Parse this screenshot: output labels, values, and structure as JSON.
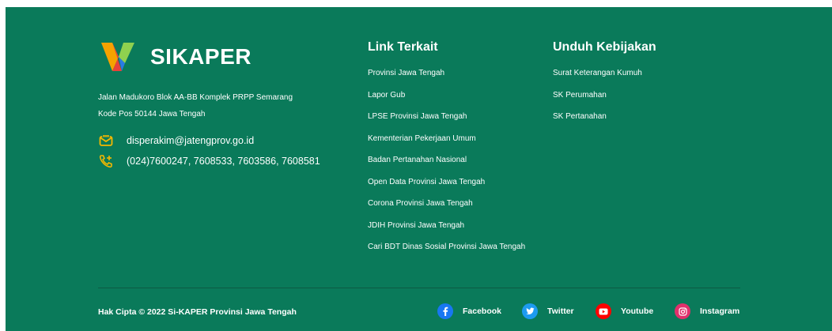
{
  "brand": {
    "name": "SIKAPER"
  },
  "address": {
    "line1": "Jalan Madukoro Blok AA-BB Komplek PRPP Semarang",
    "line2": "Kode Pos 50144 Jawa Tengah"
  },
  "contact": {
    "email": "disperakim@jatengprov.go.id",
    "phone": "(024)7600247, 7608533, 7603586, 7608581",
    "icon_color": "#f5b800"
  },
  "link_terkait": {
    "title": "Link Terkait",
    "items": [
      "Provinsi Jawa Tengah",
      "Lapor Gub",
      "LPSE Provinsi Jawa Tengah",
      "Kementerian Pekerjaan Umum",
      "Badan Pertanahan Nasional",
      "Open Data Provinsi Jawa Tengah",
      "Corona Provinsi Jawa Tengah",
      "JDIH Provinsi Jawa Tengah",
      "Cari BDT Dinas Sosial Provinsi Jawa Tengah"
    ]
  },
  "unduh_kebijakan": {
    "title": "Unduh Kebijakan",
    "items": [
      "Surat Keterangan Kumuh",
      "SK Perumahan",
      "SK Pertanahan"
    ]
  },
  "bottom": {
    "copyright": "Hak Cipta © 2022 Si-KAPER Provinsi Jawa Tengah",
    "social": [
      {
        "label": "Facebook",
        "icon": "facebook-icon",
        "color": "#1877f2"
      },
      {
        "label": "Twitter",
        "icon": "twitter-icon",
        "color": "#1d9bf0"
      },
      {
        "label": "Youtube",
        "icon": "youtube-icon",
        "color": "#ff0000"
      },
      {
        "label": "Instagram",
        "icon": "instagram-icon",
        "color": "#e1306c"
      }
    ]
  },
  "colors": {
    "background": "#0a7a5a",
    "divider": "#0d5a43"
  }
}
